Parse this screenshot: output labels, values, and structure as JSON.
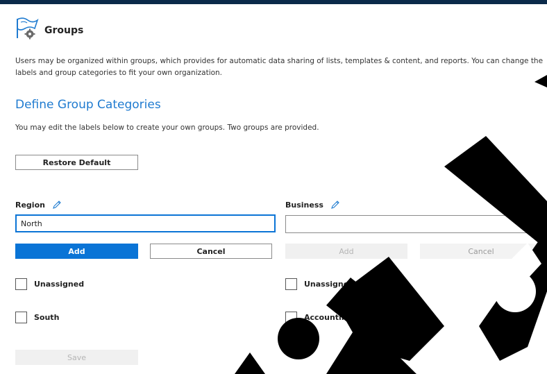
{
  "header": {
    "title": "Groups",
    "icon": "flag-gear-icon"
  },
  "intro": {
    "text": "Users may be organized within groups, which provides for automatic data sharing of lists, templates & content, and reports. You can change the labels and group categories to fit your own organization."
  },
  "section": {
    "title": "Define Group Categories",
    "description": "You may edit the labels below to create your own groups. Two groups are provided.",
    "restore_label": "Restore Default"
  },
  "region": {
    "label": "Region",
    "input_value": "North",
    "add_label": "Add",
    "cancel_label": "Cancel",
    "items": [
      "Unassigned",
      "South"
    ]
  },
  "business": {
    "label": "Business",
    "input_value": "",
    "add_label": "Add",
    "cancel_label": "Cancel",
    "items": [
      "Unassigned",
      "Accounting"
    ]
  },
  "footer": {
    "save_label": "Save"
  },
  "colors": {
    "accent": "#0a74d6",
    "heading": "#1f7bd0",
    "topbar": "#0b2a4a"
  }
}
